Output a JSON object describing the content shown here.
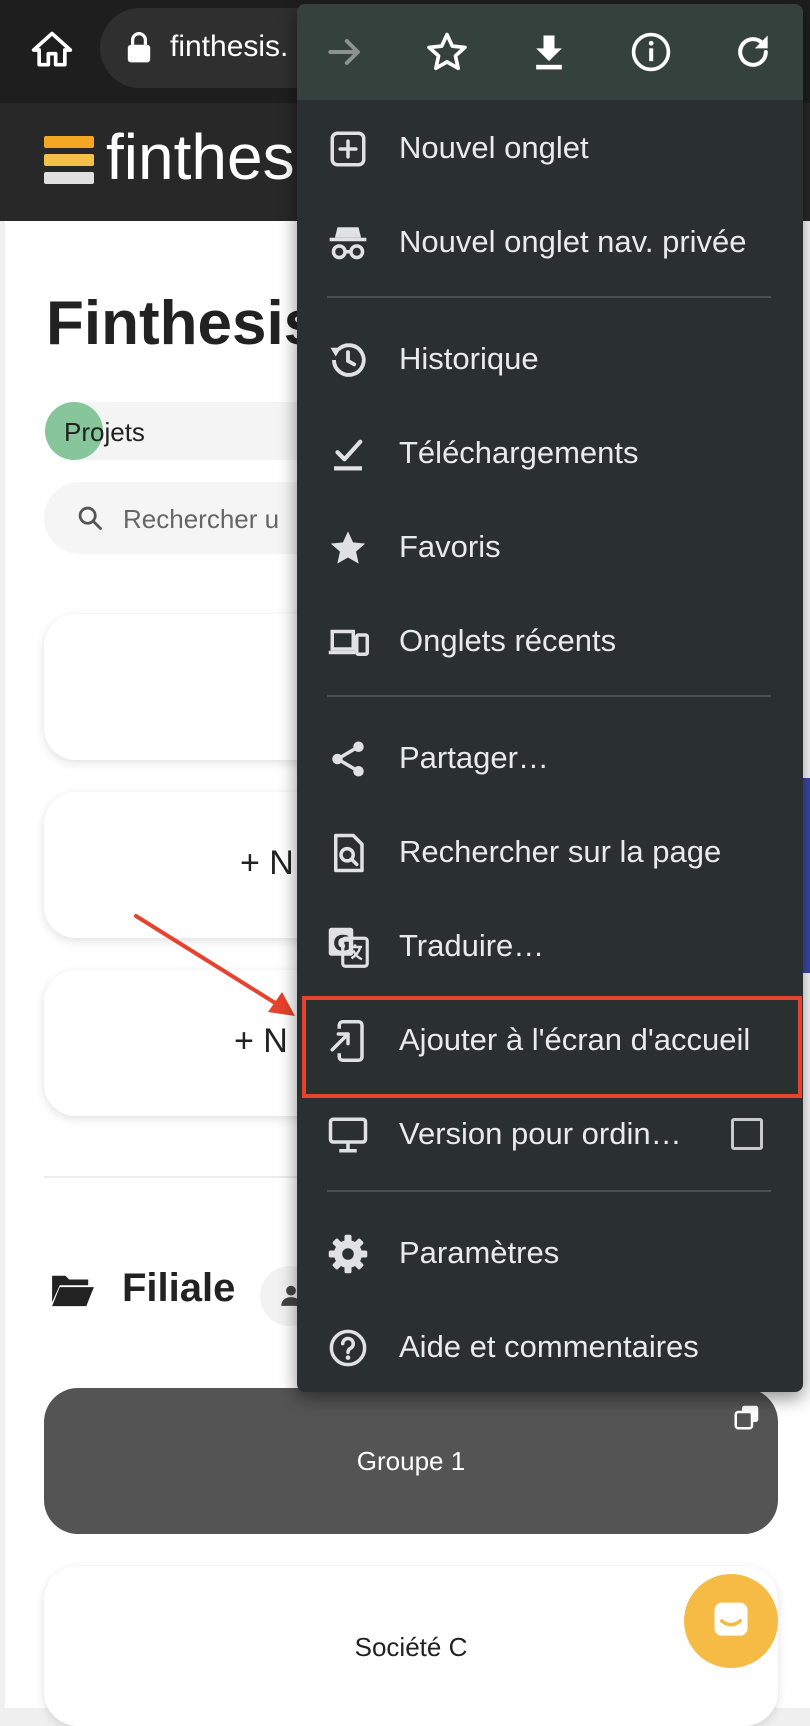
{
  "browser": {
    "url_text": "finthesis.",
    "toolbar_icons": [
      "forward-icon",
      "star-icon",
      "download-icon",
      "info-icon",
      "refresh-icon"
    ]
  },
  "site": {
    "logo_text": "finthes",
    "page_title": "Finthesis",
    "tab_label": "Projets",
    "search_placeholder": "Rechercher u",
    "card2_label": "+ N",
    "card3_label": "+ N",
    "section_title": "Filiale",
    "group_label": "Groupe 1",
    "societe_label": "Société C"
  },
  "menu": {
    "items": [
      {
        "label": "Nouvel onglet",
        "icon": "new-tab-icon"
      },
      {
        "label": "Nouvel onglet nav. privée",
        "icon": "incognito-icon"
      },
      {
        "label": "Historique",
        "icon": "history-icon"
      },
      {
        "label": "Téléchargements",
        "icon": "downloads-icon"
      },
      {
        "label": "Favoris",
        "icon": "bookmarks-icon"
      },
      {
        "label": "Onglets récents",
        "icon": "recent-tabs-icon"
      },
      {
        "label": "Partager…",
        "icon": "share-icon"
      },
      {
        "label": "Rechercher sur la page",
        "icon": "find-in-page-icon"
      },
      {
        "label": "Traduire…",
        "icon": "translate-icon"
      },
      {
        "label": "Ajouter à l'écran d'accueil",
        "icon": "add-to-home-icon"
      },
      {
        "label": "Version pour ordin…",
        "icon": "desktop-icon"
      },
      {
        "label": "Paramètres",
        "icon": "settings-icon"
      },
      {
        "label": "Aide et commentaires",
        "icon": "help-icon"
      }
    ],
    "highlighted_item": "Ajouter à l'écran d'accueil"
  },
  "colors": {
    "menu_bg": "#2a302f",
    "menu_toolbar_bg": "#35413c",
    "highlight": "#e5432d",
    "logo_orange": "#f5a623",
    "chat_button": "#f6bb45",
    "tab_dot": "#86c69a"
  }
}
